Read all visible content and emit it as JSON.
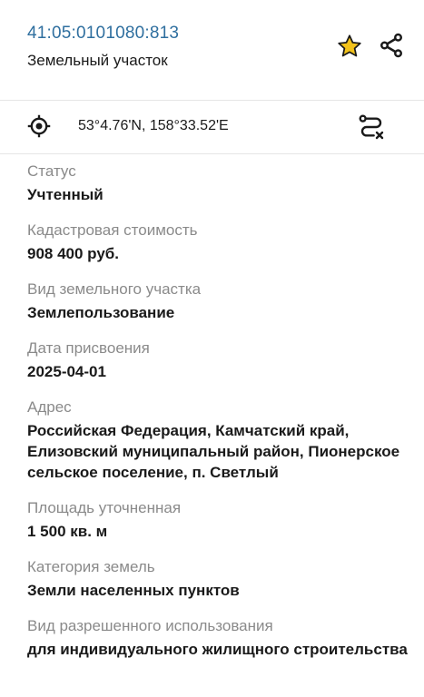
{
  "header": {
    "cadastral_number": "41:05:0101080:813",
    "object_type": "Земельный участок",
    "favorite_icon": "star-icon",
    "share_icon": "share-icon",
    "accent_color": "#2f6f9f",
    "star_color": "#f2c21b"
  },
  "location": {
    "locate_icon": "crosshair-icon",
    "coordinates": "53°4.76'N, 158°33.52'E",
    "route_icon": "route-clear-icon"
  },
  "properties": [
    {
      "label": "Статус",
      "value": "Учтенный"
    },
    {
      "label": "Кадастровая стоимость",
      "value": "908 400 руб."
    },
    {
      "label": "Вид земельного участка",
      "value": "Землепользование"
    },
    {
      "label": "Дата присвоения",
      "value": "2025-04-01"
    },
    {
      "label": "Адрес",
      "value": "Российская Федерация, Камчатский край, Елизовский муниципальный район, Пионерское сельское поселение, п. Светлый"
    },
    {
      "label": "Площадь уточненная",
      "value": "1 500 кв. м"
    },
    {
      "label": "Категория земель",
      "value": "Земли населенных пунктов"
    },
    {
      "label": "Вид разрешенного использования",
      "value": "для индивидуального жилищного строительства"
    }
  ]
}
